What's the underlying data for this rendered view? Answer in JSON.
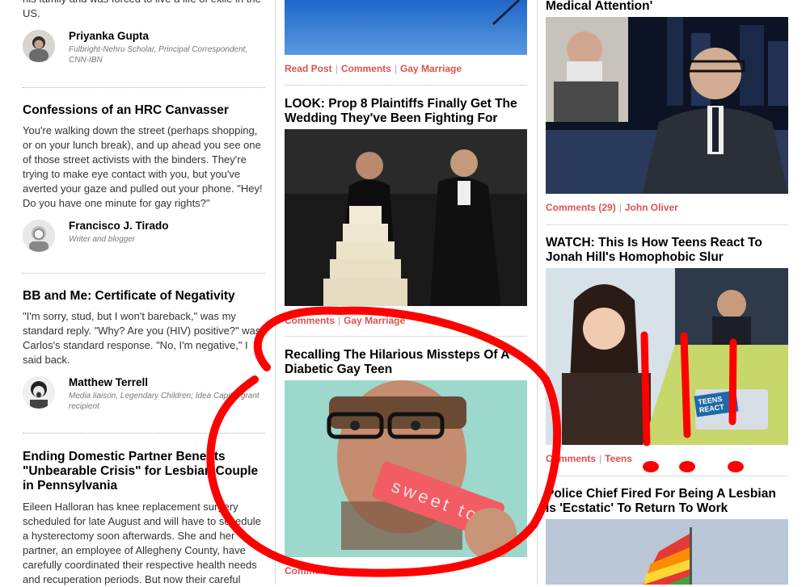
{
  "col1": {
    "intro_text": "his family and was forced to live a life of exile in the US.",
    "author1": {
      "name": "Priyanka Gupta",
      "role": "Fulbright-Nehru Scholar, Principal Correspondent, CNN-IBN"
    },
    "post2": {
      "title": "Confessions of an HRC Canvasser",
      "excerpt": "You're walking down the street (perhaps shopping, or on your lunch break), and up ahead you see one of those street activists with the binders. They're trying to make eye contact with you, but you've averted your gaze and pulled out your phone. \"Hey! Do you have one minute for gay rights?\"",
      "author": {
        "name": "Francisco J. Tirado",
        "role": "Writer and blogger"
      }
    },
    "post3": {
      "title": "BB and Me: Certificate of Negativity",
      "excerpt": "\"I'm sorry, stud, but I won't bareback,\" was my standard reply. \"Why? Are you (HIV) positive?\" was Carlos's standard response. \"No, I'm negative,\" I said back.",
      "author": {
        "name": "Matthew Terrell",
        "role": "Media liaison, Legendary Children; Idea Capital grant recipient"
      }
    },
    "post4": {
      "title": "Ending Domestic Partner Benefits \"Unbearable Crisis\" for Lesbian Couple in Pennsylvania",
      "excerpt": "Eileen Halloran has knee replacement surgery scheduled for late August and will have to schedule a hysterectomy soon afterwards. She and her partner, an employee of Allegheny County, have carefully coordinated their respective health needs and recuperation periods. But now their careful"
    }
  },
  "col2": {
    "links1": {
      "read_post": "Read Post",
      "comments": "Comments",
      "tag": "Gay Marriage"
    },
    "story2": {
      "title": "LOOK: Prop 8 Plaintiffs Finally Get The Wedding They've Been Fighting For",
      "comments": "Comments",
      "tag": "Gay Marriage"
    },
    "story3": {
      "title": "Recalling The Hilarious Missteps Of A Diabetic Gay Teen",
      "image_text": "sweet tooth",
      "comments": "Comments"
    }
  },
  "col3": {
    "story1": {
      "title_tail": "Medical Attention'",
      "comments": "Comments (29)",
      "tag": "John Oliver"
    },
    "story2": {
      "title": "WATCH: This Is How Teens React To Jonah Hill's Homophobic Slur",
      "badge": "TEENS REACT",
      "comments": "Comments",
      "tag": "Teens"
    },
    "story3": {
      "title": "Police Chief Fired For Being A Lesbian Is 'Ecstatic' To Return To Work"
    }
  },
  "colors": {
    "link_red": "#d9534f",
    "annotation_red": "#ff0000",
    "divider": "#dcdcdc"
  }
}
